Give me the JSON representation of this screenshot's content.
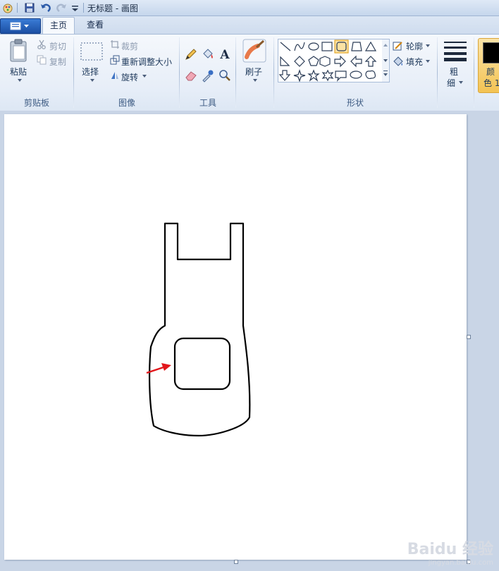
{
  "window": {
    "title": "无标题 - 画图"
  },
  "tabs": [
    {
      "label": "主页",
      "active": true
    },
    {
      "label": "查看",
      "active": false
    }
  ],
  "ribbon": {
    "clipboard": {
      "paste_label": "粘贴",
      "cut_label": "剪切",
      "copy_label": "复制",
      "group_label": "剪贴板"
    },
    "image": {
      "select_label": "选择",
      "crop_label": "裁剪",
      "resize_label": "重新调整大小",
      "rotate_label": "旋转",
      "group_label": "图像"
    },
    "tools": {
      "group_label": "工具",
      "text_tool_glyph": "A"
    },
    "brushes": {
      "label": "刷子"
    },
    "shapes": {
      "group_label": "形状",
      "outline_label": "轮廓",
      "fill_label": "填充"
    },
    "size": {
      "label_1": "粗",
      "label_2": "细"
    },
    "colors": {
      "label_1": "颜",
      "label_2": "色 1",
      "color1": "#000000",
      "accent": "#f3c353"
    }
  },
  "watermark": {
    "brand": "Baidu 经验",
    "site": "jingyan.baidu.com"
  }
}
